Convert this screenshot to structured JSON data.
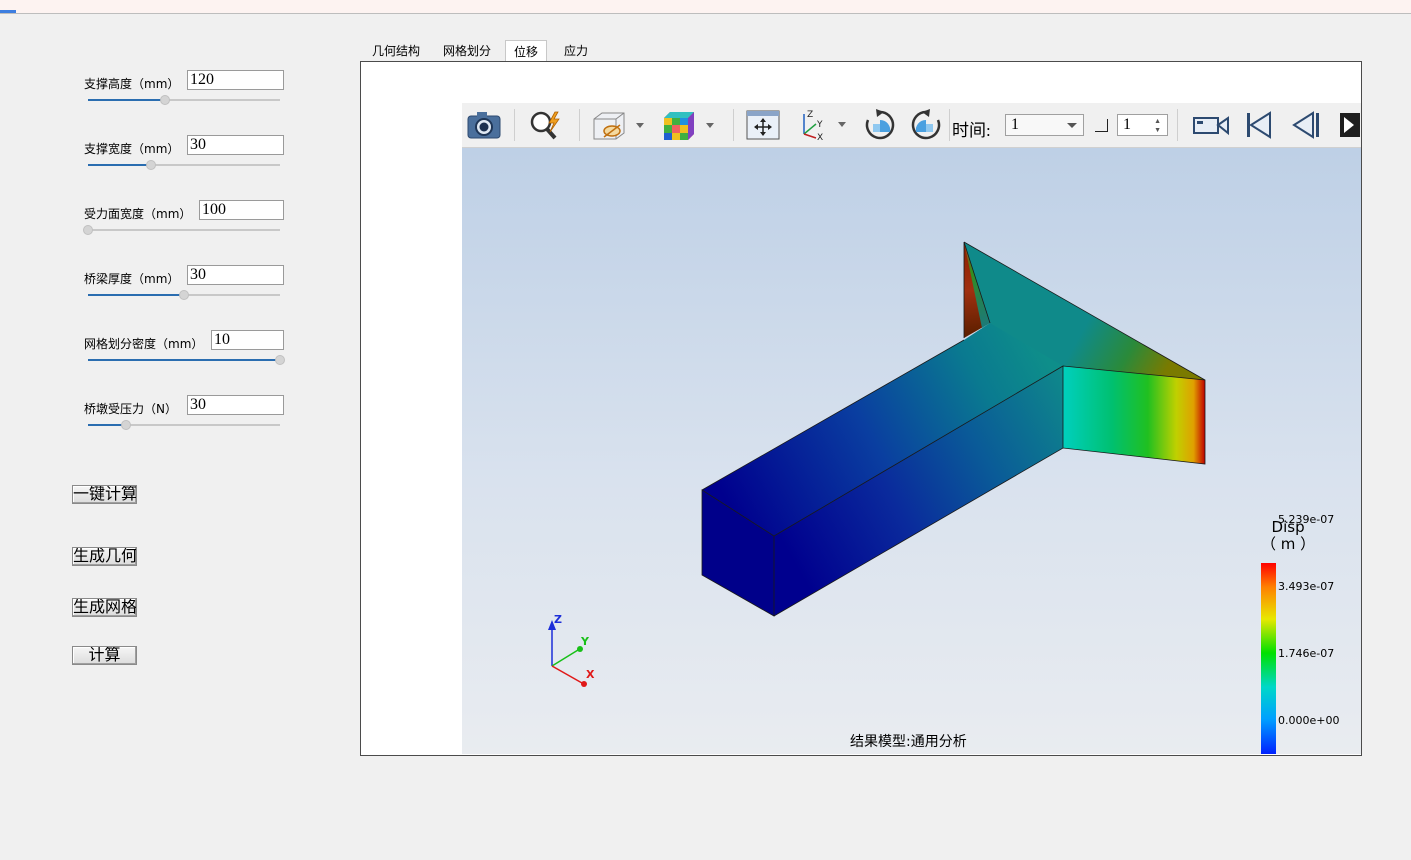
{
  "params": [
    {
      "label": "支撑高度（mm）",
      "value": "120",
      "level": 0.4
    },
    {
      "label": "支撑宽度（mm）",
      "value": "30",
      "level": 0.33
    },
    {
      "label": "受力面宽度（mm）",
      "value": "100",
      "level": 0.0
    },
    {
      "label": "桥梁厚度（mm）",
      "value": "30",
      "level": 0.5
    },
    {
      "label": "网格划分密度（mm）",
      "value": "10",
      "level": 1.0
    },
    {
      "label": "桥墩受压力（N）",
      "value": "30",
      "level": 0.2
    }
  ],
  "buttons": {
    "one_click": "一键计算",
    "gen_geometry": "生成几何",
    "gen_mesh": "生成网格",
    "compute": "计算"
  },
  "tabs": [
    {
      "label": "几何结构",
      "active": false
    },
    {
      "label": "网格划分",
      "active": false
    },
    {
      "label": "位移",
      "active": true
    },
    {
      "label": "应力",
      "active": false
    }
  ],
  "toolbar": {
    "time_label": "时间:",
    "time_value": "1",
    "step_value": "1",
    "icons": [
      "camera-icon",
      "magnify-lightning-icon",
      "view-box-icon",
      "color-cube-icon",
      "fit-view-icon",
      "axes-icon",
      "rotate-cw-icon",
      "rotate-ccw-icon",
      "video-icon",
      "skip-first-icon",
      "step-back-icon",
      "play-icon"
    ]
  },
  "legend": {
    "title": "Disp",
    "unit": "（ m ）",
    "ticks": [
      "5.239e-07",
      "3.493e-07",
      "1.746e-07",
      "0.000e+00"
    ],
    "colors": [
      "#ff0000",
      "#e8e800",
      "#00e000",
      "#00d8c8",
      "#0000ff"
    ]
  },
  "axes": {
    "x": "X",
    "y": "Y",
    "z": "Z"
  },
  "caption": "结果模型:通用分析"
}
